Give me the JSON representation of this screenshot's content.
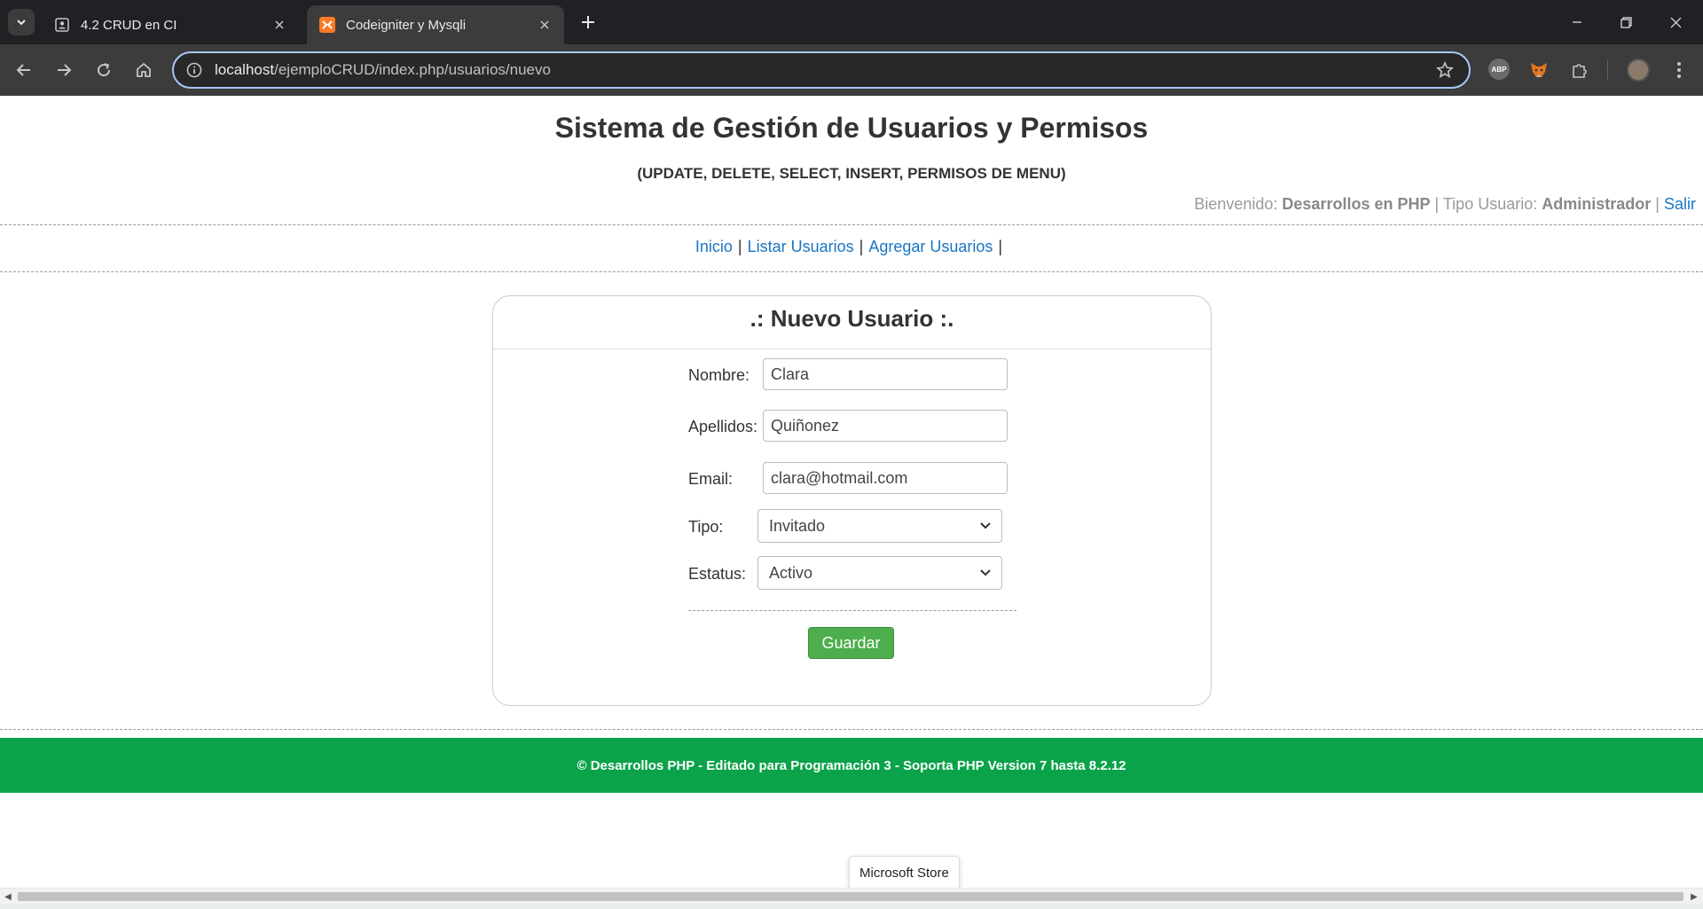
{
  "browser": {
    "tabs": [
      {
        "title": "4.2 CRUD en CI",
        "active": false
      },
      {
        "title": "Codeigniter y Mysqli",
        "active": true
      }
    ],
    "url_host": "localhost",
    "url_path": "/ejemploCRUD/index.php/usuarios/nuevo"
  },
  "header": {
    "title": "Sistema de Gestión de Usuarios y Permisos",
    "subtitle": "(UPDATE, DELETE, SELECT, INSERT, PERMISOS DE MENU)",
    "welcome_label": "Bienvenido:",
    "user_name": "Desarrollos en PHP",
    "sep": "|",
    "type_label": "Tipo Usuario:",
    "user_type": "Administrador",
    "logout": "Salir"
  },
  "menu": {
    "items": [
      "Inicio",
      "Listar Usuarios",
      "Agregar Usuarios"
    ],
    "sep": "|"
  },
  "form": {
    "title": ".: Nuevo Usuario :.",
    "nombre_label": "Nombre:",
    "nombre_value": "Clara",
    "apellidos_label": "Apellidos:",
    "apellidos_value": "Quiñonez",
    "email_label": "Email:",
    "email_value": "clara@hotmail.com",
    "tipo_label": "Tipo:",
    "tipo_value": "Invitado",
    "estatus_label": "Estatus:",
    "estatus_value": "Activo",
    "save_label": "Guardar"
  },
  "footer": {
    "text": "© Desarrollos PHP - Editado para Programación 3 - Soporta PHP Version 7 hasta 8.2.12"
  },
  "tooltip": {
    "text": "Microsoft Store"
  },
  "colors": {
    "footer_green": "#0ba34a",
    "button_green": "#4cae4c",
    "link_blue": "#1a75c4"
  }
}
